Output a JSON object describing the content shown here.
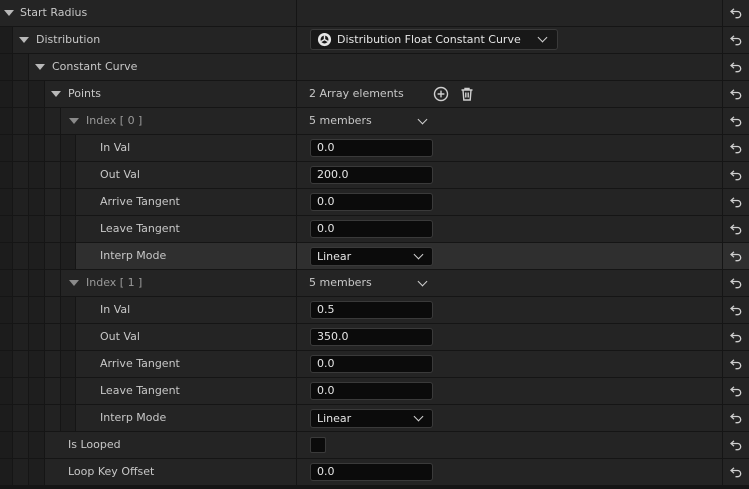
{
  "rows": [
    {
      "id": "start-radius",
      "label": "Start Radius",
      "depth": 0,
      "expander": true
    },
    {
      "id": "distribution",
      "label": "Distribution",
      "depth": 1,
      "expander": true,
      "value_type": "class-combo",
      "value": "Distribution Float Constant Curve",
      "value_icon": "distribution-icon"
    },
    {
      "id": "constant-curve",
      "label": "Constant Curve",
      "depth": 2,
      "expander": true
    },
    {
      "id": "points",
      "label": "Points",
      "depth": 3,
      "expander": true,
      "value_type": "array",
      "value": "2 Array elements",
      "array_icons": [
        "add-element-icon",
        "delete-all-icon"
      ]
    },
    {
      "id": "index-0",
      "label": "Index [ 0 ]",
      "depth": 4,
      "expander": true,
      "dim": true,
      "value_type": "members",
      "value": "5 members"
    },
    {
      "id": "index-0-in-val",
      "label": "In Val",
      "depth": 5,
      "value_type": "number",
      "value": "0.0"
    },
    {
      "id": "index-0-out-val",
      "label": "Out Val",
      "depth": 5,
      "value_type": "number",
      "value": "200.0"
    },
    {
      "id": "index-0-arrive-tangent",
      "label": "Arrive Tangent",
      "depth": 5,
      "value_type": "number",
      "value": "0.0"
    },
    {
      "id": "index-0-leave-tangent",
      "label": "Leave Tangent",
      "depth": 5,
      "value_type": "number",
      "value": "0.0"
    },
    {
      "id": "index-0-interp-mode",
      "label": "Interp Mode",
      "depth": 5,
      "highlight": true,
      "value_type": "enum",
      "value": "Linear"
    },
    {
      "id": "index-1",
      "label": "Index [ 1 ]",
      "depth": 4,
      "expander": true,
      "dim": true,
      "value_type": "members",
      "value": "5 members"
    },
    {
      "id": "index-1-in-val",
      "label": "In Val",
      "depth": 5,
      "value_type": "number",
      "value": "0.5"
    },
    {
      "id": "index-1-out-val",
      "label": "Out Val",
      "depth": 5,
      "value_type": "number",
      "value": "350.0"
    },
    {
      "id": "index-1-arrive-tangent",
      "label": "Arrive Tangent",
      "depth": 5,
      "value_type": "number",
      "value": "0.0"
    },
    {
      "id": "index-1-leave-tangent",
      "label": "Leave Tangent",
      "depth": 5,
      "value_type": "number",
      "value": "0.0"
    },
    {
      "id": "index-1-interp-mode",
      "label": "Interp Mode",
      "depth": 5,
      "value_type": "enum",
      "value": "Linear"
    },
    {
      "id": "is-looped",
      "label": "Is Looped",
      "depth": 3,
      "value_type": "checkbox",
      "value_checked": false
    },
    {
      "id": "loop-key-offset",
      "label": "Loop Key Offset",
      "depth": 3,
      "value_type": "number",
      "value": "0.0"
    }
  ],
  "reset_icon": "reset-to-default-icon",
  "colors": {
    "panel_bg": "#151515",
    "row_bg": "#242424",
    "row_highlight": "#2f2f2f",
    "field_bg": "#0b0b0b",
    "text": "#c8c8c8",
    "dim_text": "#9a9a9a"
  }
}
